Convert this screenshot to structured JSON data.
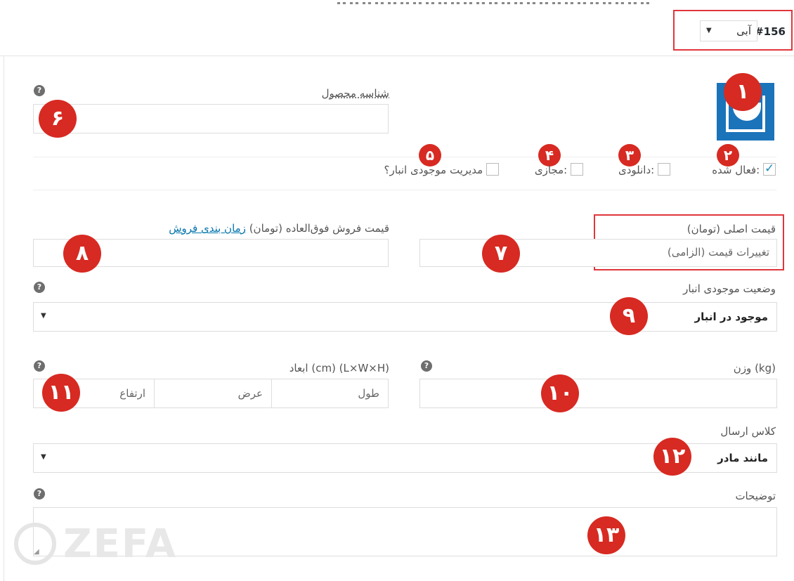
{
  "variation": {
    "id_label": "#156",
    "color_value": "آبی"
  },
  "sku": {
    "label": "شناسه محصول",
    "value": ""
  },
  "options": {
    "enabled_label": "فعال شده:",
    "enabled_checked": true,
    "downloadable_label": "دانلودی:",
    "virtual_label": "مجازی:",
    "manage_stock_label": "مدیریت موجودی انبار؟"
  },
  "pricing": {
    "regular_label": "قیمت اصلی (تومان)",
    "regular_placeholder": "تغییرات قیمت (الزامی)",
    "sale_label": "قیمت فروش فوق‌العاده (تومان)",
    "schedule_link": "زمان بندی فروش"
  },
  "stock_status": {
    "label": "وضعیت موجودی انبار",
    "value": "موجود در انبار"
  },
  "weight": {
    "label": "وزن (kg)"
  },
  "dimensions": {
    "label": "ابعاد (cm) (L×W×H)",
    "length_placeholder": "طول",
    "width_placeholder": "عرض",
    "height_placeholder": "ارتفاع"
  },
  "shipping_class": {
    "label": "کلاس ارسال",
    "value": "مانند مادر"
  },
  "description": {
    "label": "توضیحات"
  },
  "badges": [
    "۱",
    "۲",
    "۳",
    "۴",
    "۵",
    "۶",
    "۷",
    "۸",
    "۹",
    "۱۰",
    "۱۱",
    "۱۲",
    "۱۳"
  ],
  "help_glyph": "?",
  "watermark": "ZEFA",
  "colors": {
    "accent_red": "#d72a22",
    "link_blue": "#0073aa",
    "thumb_blue": "#1b73ba"
  }
}
